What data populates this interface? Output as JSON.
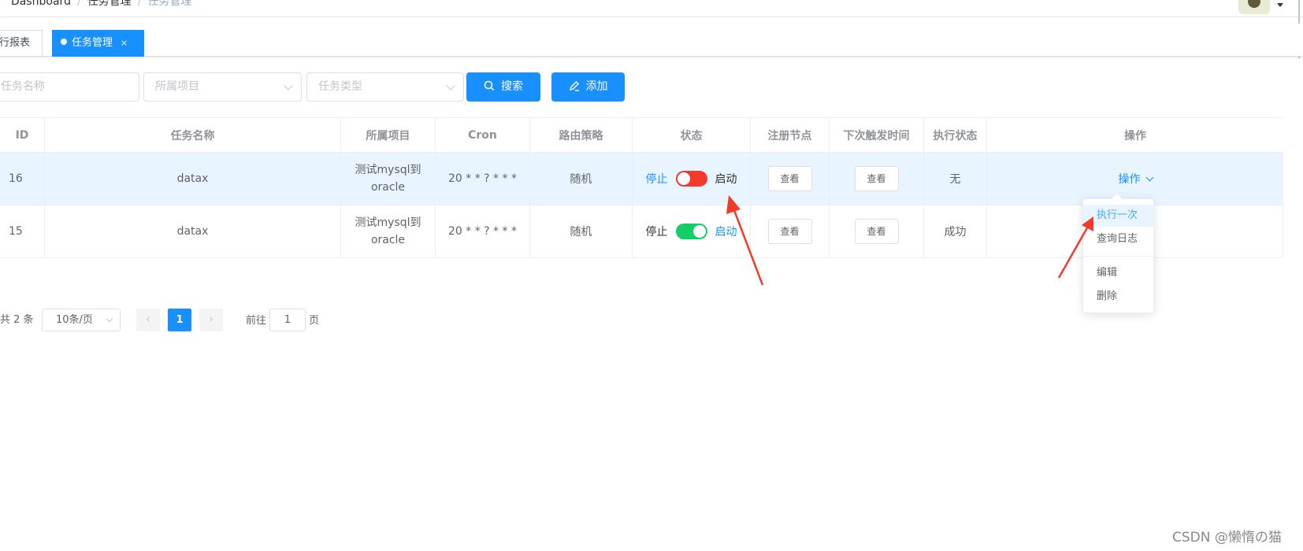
{
  "header": {
    "breadcrumb": [
      "Dashboard",
      "任务管理",
      "任务管理"
    ]
  },
  "tags": [
    {
      "label": "行报表"
    },
    {
      "label": "任务管理",
      "close": "×"
    }
  ],
  "filters": {
    "task_name_placeholder": "任务名称",
    "project_placeholder": "所属项目",
    "task_type_placeholder": "任务类型",
    "search_label": "搜索",
    "add_label": "添加"
  },
  "table": {
    "headers": [
      "ID",
      "任务名称",
      "所属项目",
      "Cron",
      "路由策略",
      "状态",
      "注册节点",
      "下次触发时间",
      "执行状态",
      "操作"
    ],
    "rows": [
      {
        "id": "16",
        "name": "datax",
        "project": "测试mysql到oracle",
        "cron": "20 * * ? * * *",
        "route": "随机",
        "stop_label": "停止",
        "start_label": "启动",
        "switch_on": false,
        "switch_color": "#f5392a",
        "node_btn": "查看",
        "next_btn": "查看",
        "exec_status": "无",
        "op_label": "操作"
      },
      {
        "id": "15",
        "name": "datax",
        "project": "测试mysql到oracle",
        "cron": "20 * * ? * * *",
        "route": "随机",
        "stop_label": "停止",
        "start_label": "启动",
        "switch_on": true,
        "switch_color": "#13ce66",
        "node_btn": "查看",
        "next_btn": "查看",
        "exec_status": "成功"
      }
    ]
  },
  "dropdown": {
    "items": [
      "执行一次",
      "查询日志",
      "编辑",
      "删除"
    ]
  },
  "pagination": {
    "total_text": "共 2 条",
    "page_size": "10条/页",
    "prev": "‹",
    "next": "›",
    "current_page": "1",
    "goto_prefix": "前往",
    "goto_value": "1",
    "goto_suffix": "页"
  },
  "watermark": "CSDN @懒惰の猫",
  "colors": {
    "primary": "#1890ff",
    "switch_off": "#f5392a",
    "switch_on": "#13ce66",
    "annotation_arrow": "#f23c2b"
  },
  "icons": [
    "search-icon",
    "edit-icon",
    "chevron-down-icon",
    "avatar",
    "annotation-arrow"
  ]
}
